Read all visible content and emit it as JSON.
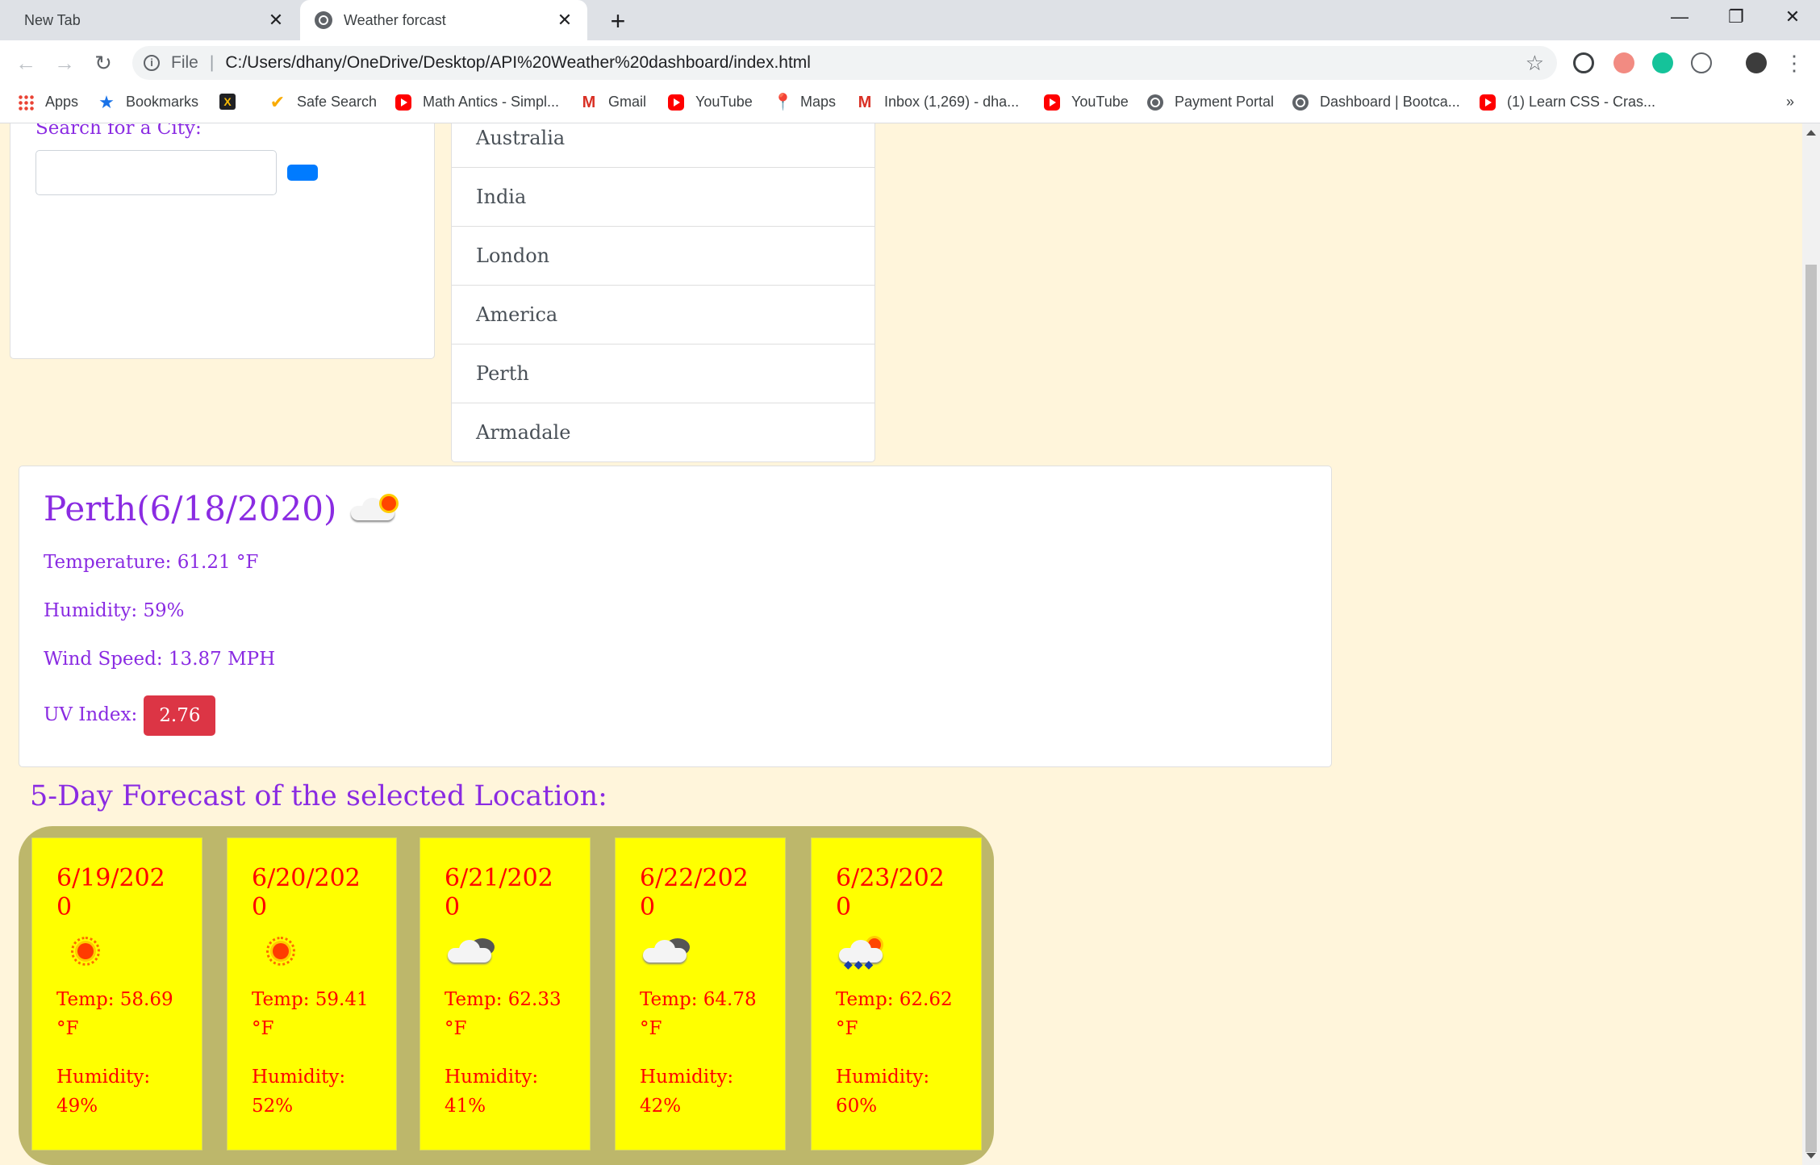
{
  "browser": {
    "tabs": [
      {
        "title": "New Tab",
        "active": false
      },
      {
        "title": "Weather forcast",
        "active": true
      }
    ],
    "address": {
      "scheme": "File",
      "url": "C:/Users/dhany/OneDrive/Desktop/API%20Weather%20dashboard/index.html"
    },
    "bookmarks": [
      {
        "label": "Apps",
        "icon": "apps-icon"
      },
      {
        "label": "Bookmarks",
        "icon": "star-icon"
      },
      {
        "label": "",
        "icon": "extension-x-icon"
      },
      {
        "label": "Safe Search",
        "icon": "check-icon"
      },
      {
        "label": "Math Antics - Simpl...",
        "icon": "youtube-icon"
      },
      {
        "label": "Gmail",
        "icon": "gmail-icon"
      },
      {
        "label": "YouTube",
        "icon": "youtube-icon"
      },
      {
        "label": "Maps",
        "icon": "maps-icon"
      },
      {
        "label": "Inbox (1,269) - dha...",
        "icon": "gmail-icon"
      },
      {
        "label": "YouTube",
        "icon": "youtube-icon"
      },
      {
        "label": "Payment Portal",
        "icon": "globe-icon"
      },
      {
        "label": "Dashboard | Bootca...",
        "icon": "globe-icon"
      },
      {
        "label": "(1) Learn CSS - Cras...",
        "icon": "youtube-icon"
      }
    ],
    "overflow": "»"
  },
  "search": {
    "label": "Search for a City:",
    "value": ""
  },
  "cities": [
    "Australia",
    "India",
    "London",
    "America",
    "Perth",
    "Armadale"
  ],
  "current": {
    "title": "Perth(6/18/2020)",
    "icon": "partly-cloudy-icon",
    "temperature": "Temperature: 61.21 °F",
    "humidity": "Humidity: 59%",
    "wind": "Wind Speed: 13.87 MPH",
    "uv_label": "UV Index:",
    "uv_value": "2.76"
  },
  "forecast": {
    "heading": "5-Day Forecast of the selected Location:",
    "days": [
      {
        "date": "6/19/2020",
        "icon": "sun-icon",
        "temp": "Temp: 58.69 °F",
        "humidity": "Humidity: 49%"
      },
      {
        "date": "6/20/2020",
        "icon": "sun-icon",
        "temp": "Temp: 59.41 °F",
        "humidity": "Humidity: 52%"
      },
      {
        "date": "6/21/2020",
        "icon": "cloudy-icon",
        "temp": "Temp: 62.33 °F",
        "humidity": "Humidity: 41%"
      },
      {
        "date": "6/22/2020",
        "icon": "cloudy-icon",
        "temp": "Temp: 64.78 °F",
        "humidity": "Humidity: 42%"
      },
      {
        "date": "6/23/2020",
        "icon": "rain-icon",
        "temp": "Temp: 62.62 °F",
        "humidity": "Humidity: 60%"
      }
    ]
  },
  "colors": {
    "page_bg": "#fff5db",
    "accent_text": "#8a2be2",
    "uv_badge": "#dc3545",
    "forecast_card": "#ffff00",
    "forecast_text": "#ff0000",
    "forecast_wrap": "#bdb76b",
    "search_button": "#007bff"
  }
}
